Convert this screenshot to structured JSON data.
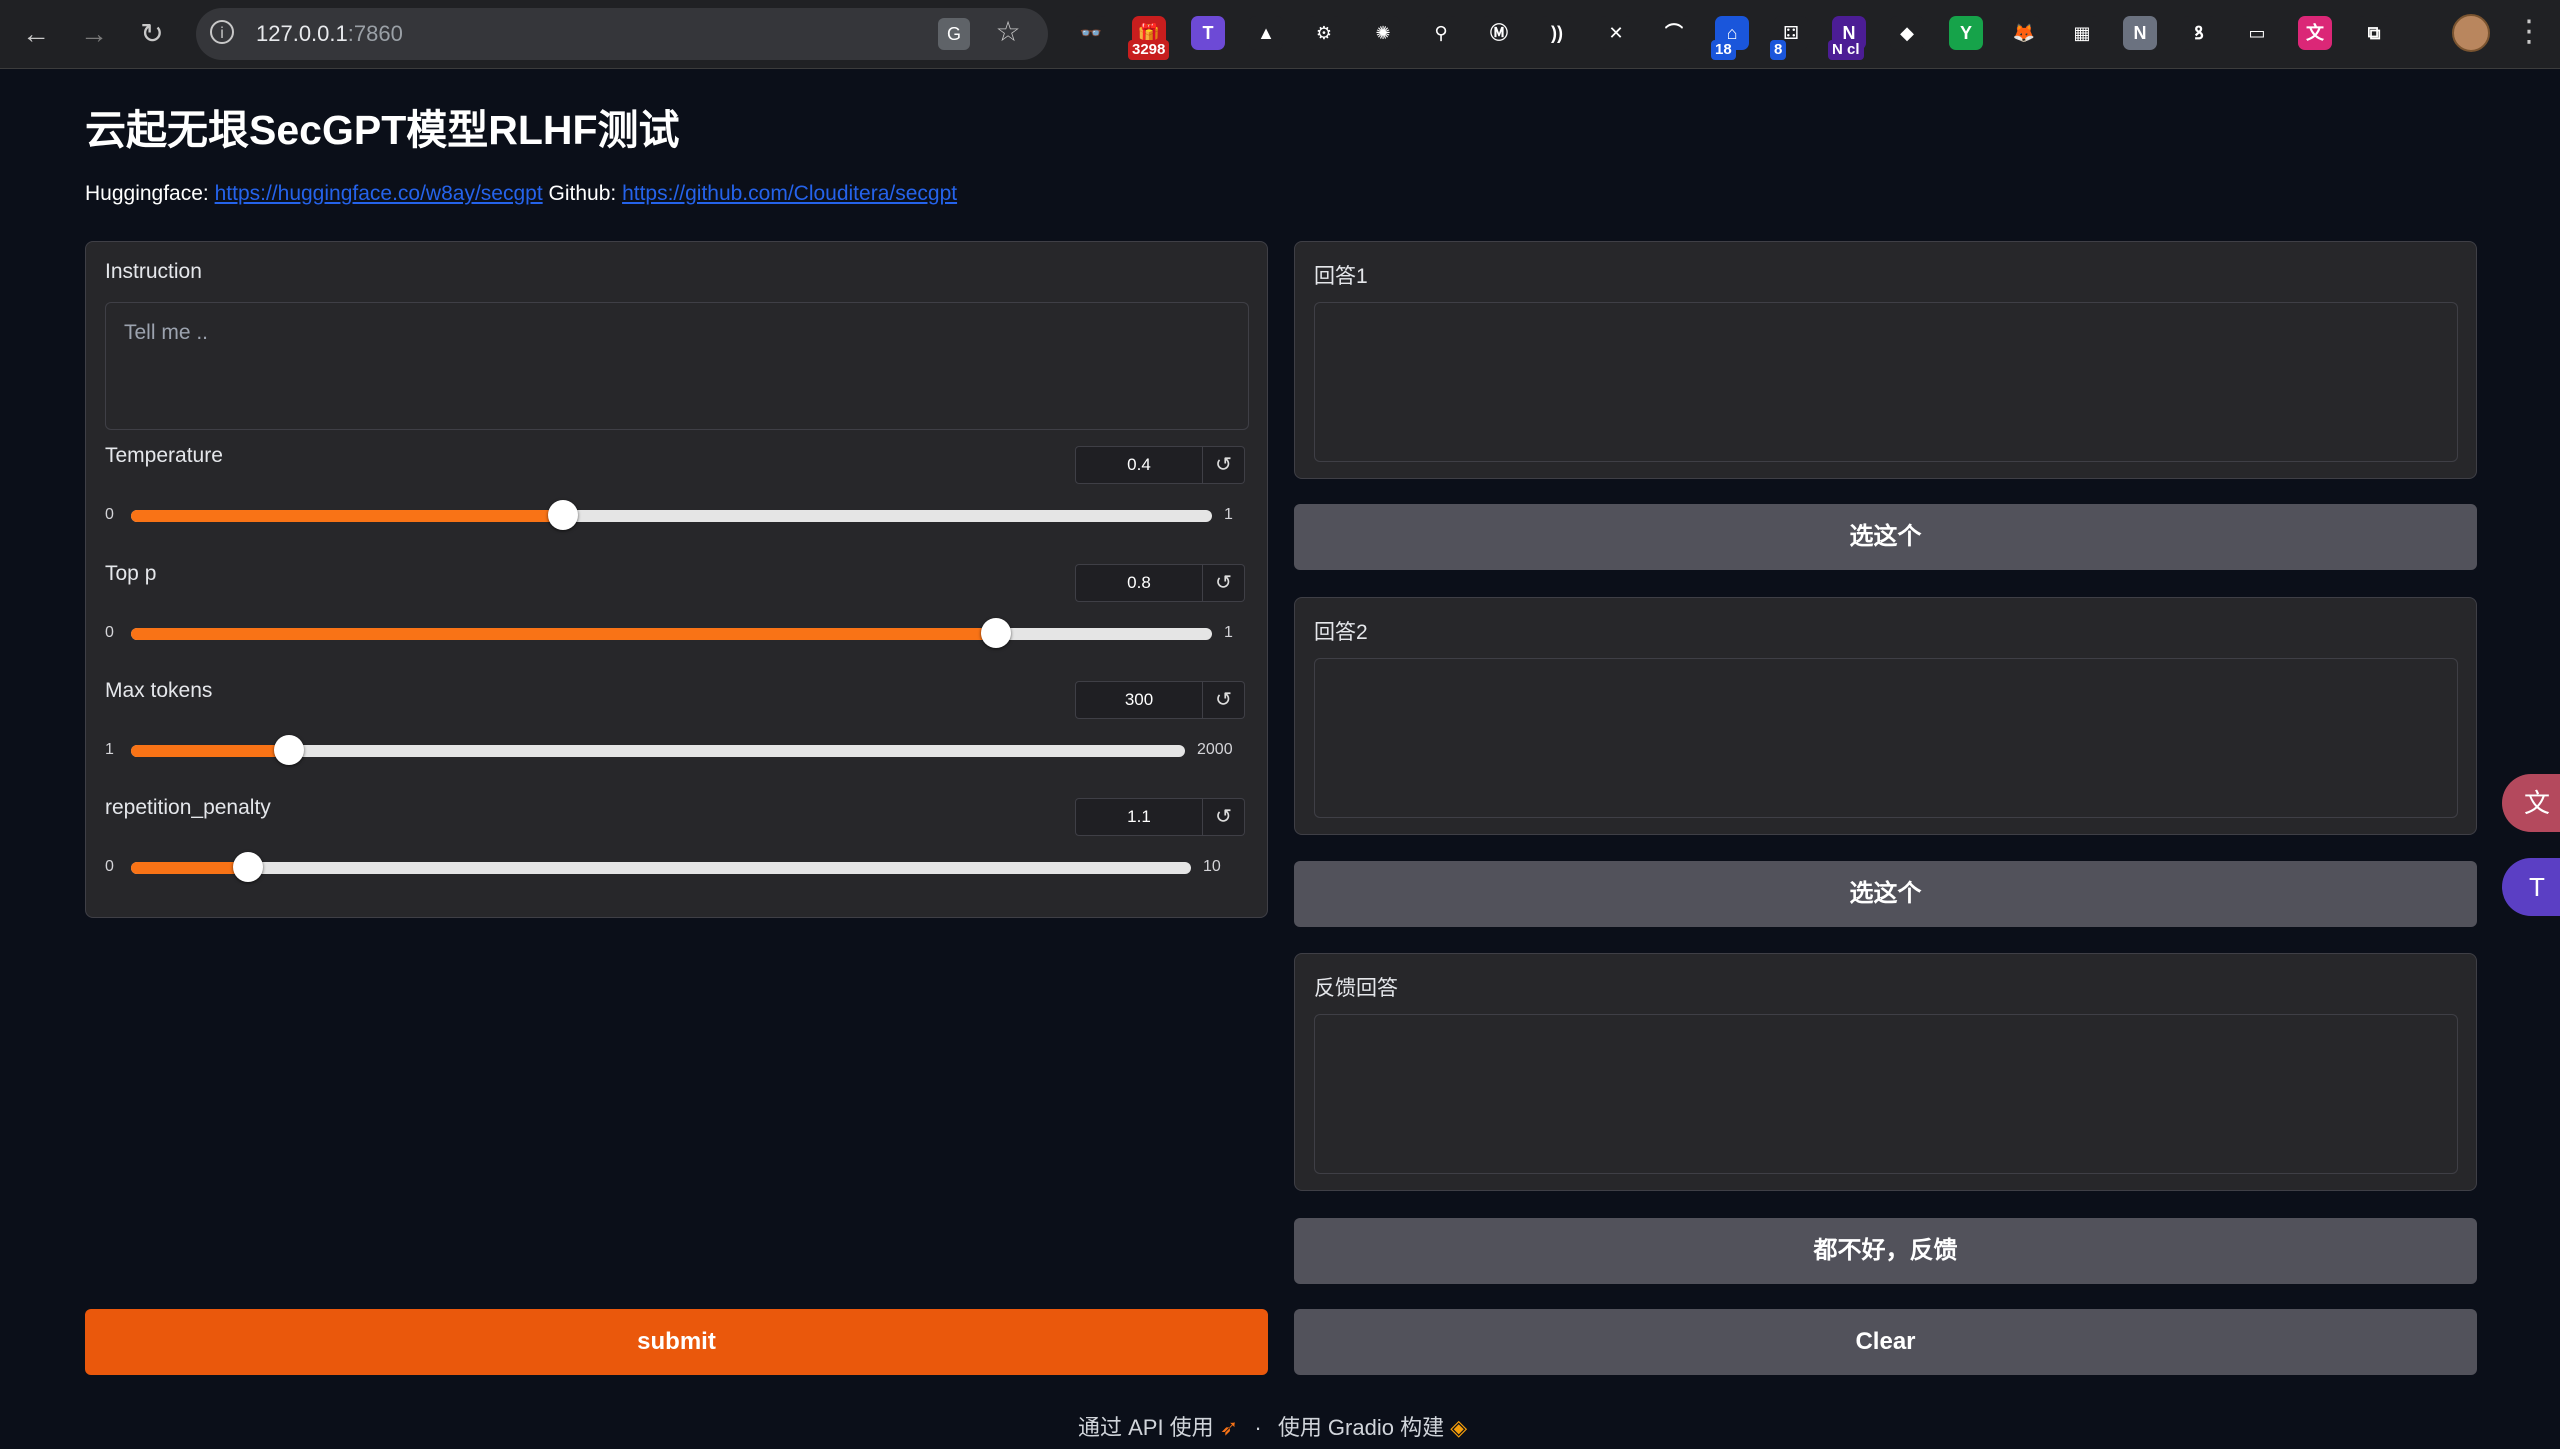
{
  "browser": {
    "url_host": "127.0.0.1",
    "url_port": ":7860",
    "extensions": [
      {
        "name": "ext-glasses",
        "glyph": "👓",
        "color": "#202124"
      },
      {
        "name": "ext-gift",
        "glyph": "🎁",
        "color": "#c81e1e",
        "badge": "3298"
      },
      {
        "name": "ext-t",
        "glyph": "T",
        "color": "#6d4ad6"
      },
      {
        "name": "ext-drive",
        "glyph": "▲",
        "color": "#202124"
      },
      {
        "name": "ext-gear",
        "glyph": "⚙",
        "color": "#202124"
      },
      {
        "name": "ext-openai",
        "glyph": "✺",
        "color": "#202124"
      },
      {
        "name": "ext-pin",
        "glyph": "⚲",
        "color": "#202124"
      },
      {
        "name": "ext-m",
        "glyph": "Ⓜ",
        "color": "#202124"
      },
      {
        "name": "ext-wave",
        "glyph": "))",
        "color": "#202124"
      },
      {
        "name": "ext-x",
        "glyph": "✕",
        "color": "#202124"
      },
      {
        "name": "ext-arc",
        "glyph": "⌒",
        "color": "#202124"
      },
      {
        "name": "ext-house",
        "glyph": "⌂",
        "color": "#1a56db",
        "badge": "18"
      },
      {
        "name": "ext-dice",
        "glyph": "⚃",
        "color": "#202124",
        "badge": "8"
      },
      {
        "name": "ext-ncl",
        "glyph": "N",
        "color": "#4c1d95",
        "badge": "N cl"
      },
      {
        "name": "ext-cube",
        "glyph": "◆",
        "color": "#202124"
      },
      {
        "name": "ext-y",
        "glyph": "Y",
        "color": "#16a34a"
      },
      {
        "name": "ext-fox",
        "glyph": "🦊",
        "color": "#202124"
      },
      {
        "name": "ext-grid",
        "glyph": "▦",
        "color": "#202124"
      },
      {
        "name": "ext-n",
        "glyph": "N",
        "color": "#6b7280"
      },
      {
        "name": "ext-bird",
        "glyph": "ꝸ",
        "color": "#202124"
      },
      {
        "name": "ext-card",
        "glyph": "▭",
        "color": "#202124"
      },
      {
        "name": "ext-translate",
        "glyph": "文",
        "color": "#db2777"
      },
      {
        "name": "ext-puzzle",
        "glyph": "⧉",
        "color": "#202124"
      }
    ]
  },
  "page": {
    "title": "云起无垠SecGPT模型RLHF测试",
    "hf_label": "Huggingface:",
    "hf_link": "https://huggingface.co/w8ay/secgpt",
    "gh_label": "Github:",
    "gh_link": "https://github.com/Clouditera/secgpt"
  },
  "left": {
    "instruction_label": "Instruction",
    "instruction_placeholder": "Tell me ..",
    "sliders": [
      {
        "label": "Temperature",
        "value_text": "0.4",
        "min": "0",
        "max": "1",
        "fraction": 0.4
      },
      {
        "label": "Top p",
        "value_text": "0.8",
        "min": "0",
        "max": "1",
        "fraction": 0.8
      },
      {
        "label": "Max tokens",
        "value_text": "300",
        "min": "1",
        "max": "2000",
        "fraction": 0.1496
      },
      {
        "label": "repetition_penalty",
        "value_text": "1.1",
        "min": "0",
        "max": "10",
        "fraction": 0.11
      }
    ],
    "submit": "submit"
  },
  "right": {
    "answer1_label": "回答1",
    "choose1": "选这个",
    "answer2_label": "回答2",
    "choose2": "选这个",
    "feedback_label": "反馈回答",
    "feedback_button": "都不好，反馈",
    "clear": "Clear"
  },
  "footer": {
    "api": "通过 API 使用",
    "dot": "·",
    "built": "使用 Gradio 构建"
  },
  "colors": {
    "accent": "#ea580c",
    "panel": "#27272a",
    "button": "#52525b"
  }
}
